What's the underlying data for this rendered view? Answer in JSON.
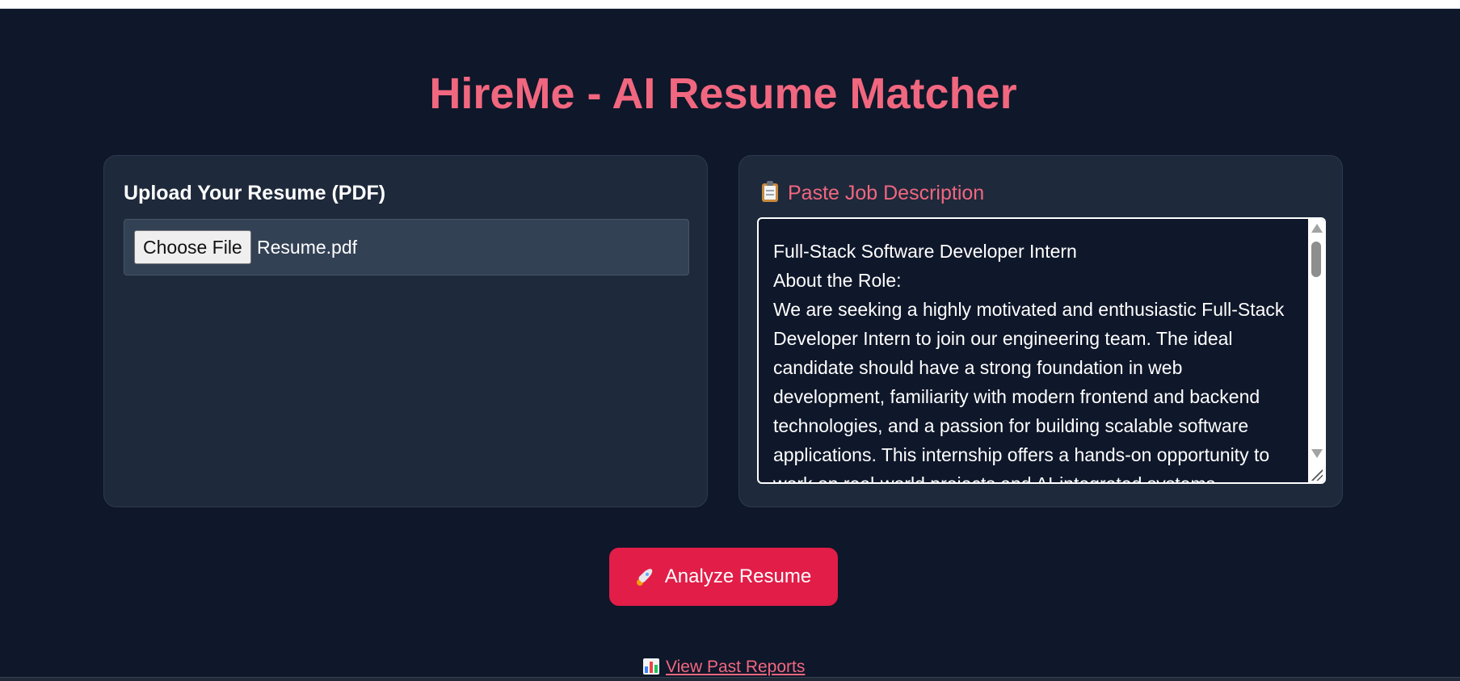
{
  "app": {
    "title": "HireMe - AI Resume Matcher"
  },
  "upload_card": {
    "heading": "Upload Your Resume (PDF)",
    "button_label": "Choose File",
    "file_name": "Resume.pdf"
  },
  "job_card": {
    "icon": "clipboard-icon",
    "heading": "Paste Job Description",
    "text": "Full-Stack Software Developer Intern\nAbout the Role:\nWe are seeking a highly motivated and enthusiastic Full-Stack Developer Intern to join our engineering team. The ideal candidate should have a strong foundation in web development, familiarity with modern frontend and backend technologies, and a passion for building scalable software applications. This internship offers a hands-on opportunity to work on real-world projects and AI-integrated systems."
  },
  "actions": {
    "analyze_icon": "rocket-icon",
    "analyze_label": "Analyze Resume",
    "reports_icon": "bar-chart-icon",
    "reports_label": "View Past Reports"
  },
  "colors": {
    "background": "#0f172a",
    "card": "#1e293b",
    "accent": "#f1677f",
    "button": "#e11d48"
  }
}
